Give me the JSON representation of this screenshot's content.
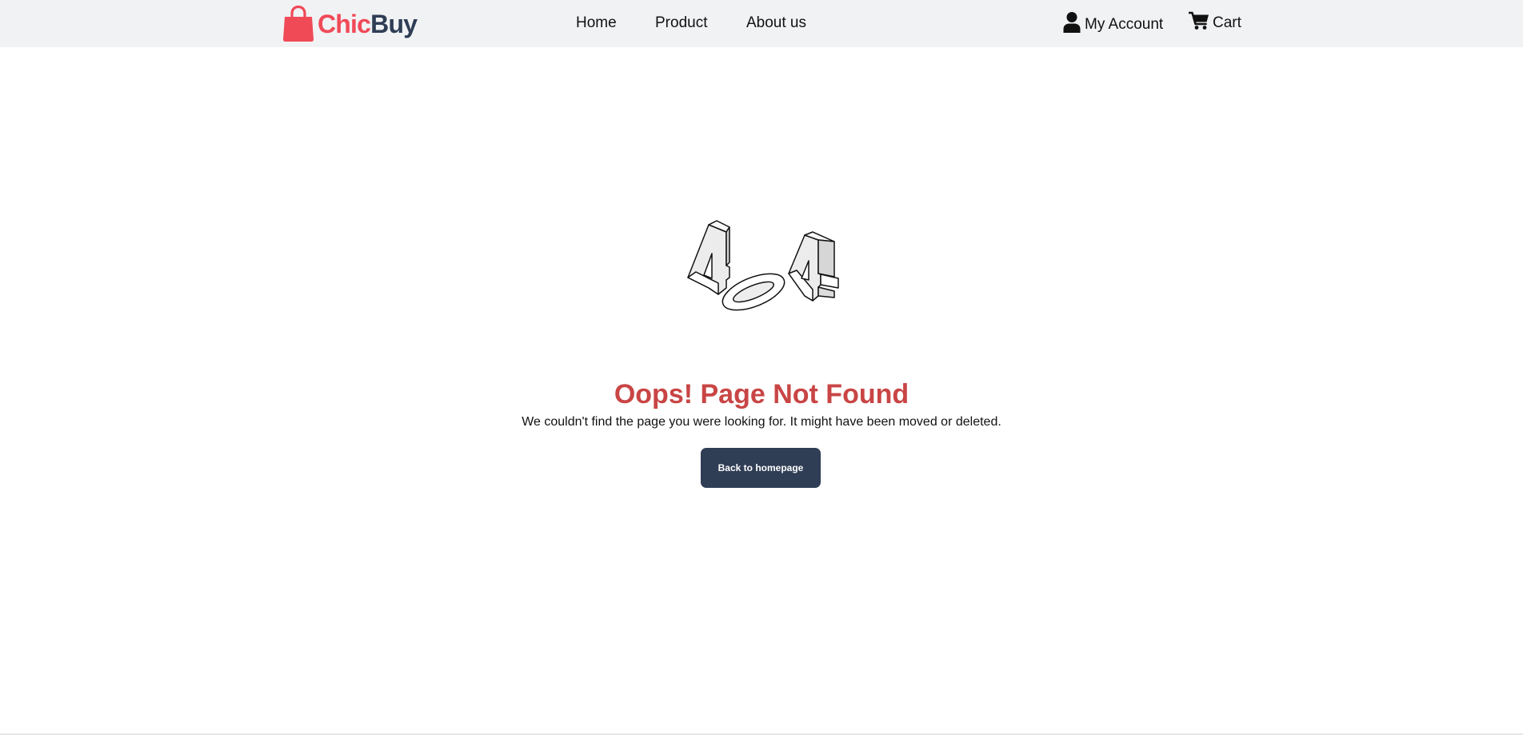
{
  "header": {
    "logo": {
      "part1": "Chic",
      "part2": "Buy",
      "icon": "shopping-bag-icon",
      "color_part1": "#f04a57",
      "color_part2": "#2f3d55"
    },
    "nav": [
      {
        "label": "Home"
      },
      {
        "label": "Product"
      },
      {
        "label": "About us"
      }
    ],
    "account": {
      "label": "My Account",
      "icon": "user-icon"
    },
    "cart": {
      "label": "Cart",
      "icon": "cart-icon"
    },
    "background": "#f1f2f4"
  },
  "main": {
    "illustration": {
      "icon": "404-illustration-icon"
    },
    "title": "Oops! Page Not Found",
    "message": "We couldn't find the page you were looking for. It might have been moved or deleted.",
    "button_label": "Back to homepage",
    "title_color": "#c94545",
    "button_color": "#2f3d55"
  }
}
